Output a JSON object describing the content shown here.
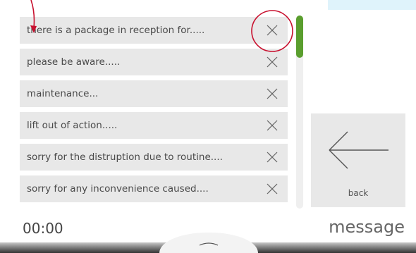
{
  "messages": [
    {
      "text": "there is  a package in reception for....."
    },
    {
      "text": "please be aware....."
    },
    {
      "text": "maintenance..."
    },
    {
      "text": "lift out of action....."
    },
    {
      "text": "sorry for the distruption due to routine...."
    },
    {
      "text": "sorry for any inconvenience caused...."
    }
  ],
  "back": {
    "label": "back"
  },
  "footer": {
    "timer": "00:00",
    "mode": "message"
  },
  "colors": {
    "row_bg": "#e8e8e8",
    "scroll_thumb": "#5a9e2e",
    "annotation": "#c8102e"
  },
  "icons": {
    "delete": "close-x-icon",
    "back": "arrow-left-icon",
    "handle": "chevron-up-icon"
  },
  "scroll": {
    "position_fraction": 0.0,
    "visible_fraction": 0.22
  }
}
